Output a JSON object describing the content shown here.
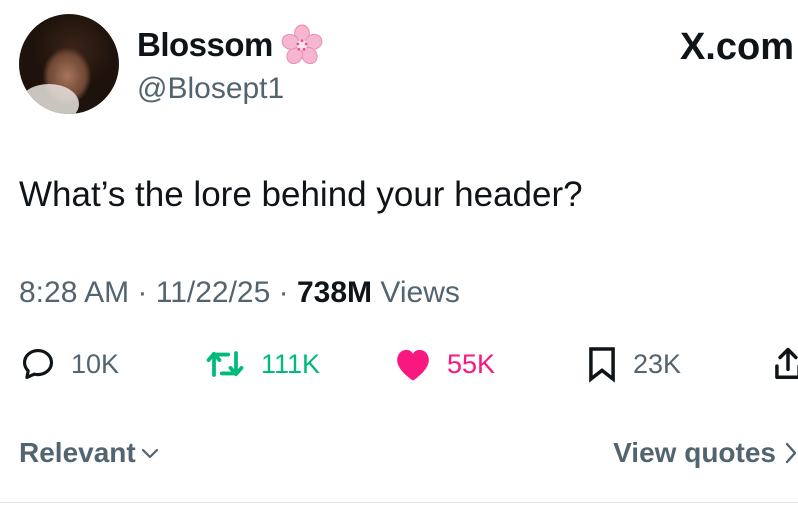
{
  "author": {
    "display_name": "Blossom",
    "name_emoji": "cherry-blossom-icon",
    "handle": "@Blosept1"
  },
  "brand": "X.com",
  "tweet": {
    "text": "What’s the lore behind your header?",
    "time": "8:28 AM",
    "date": "11/22/25",
    "views_count": "738M",
    "views_label": "Views"
  },
  "actions": {
    "replies": "10K",
    "reposts": "111K",
    "likes": "55K",
    "bookmarks": "23K"
  },
  "footer": {
    "sort_label": "Relevant",
    "quotes_label": "View quotes"
  },
  "colors": {
    "text": "#0f1419",
    "secondary": "#536471",
    "repost": "#00ba7c",
    "like": "#f91880"
  }
}
